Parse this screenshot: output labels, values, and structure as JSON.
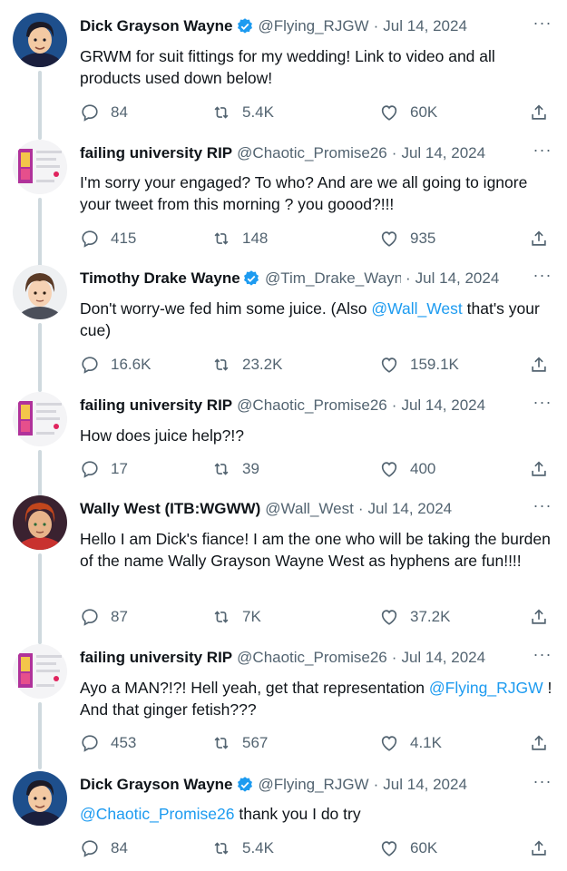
{
  "tweets": [
    {
      "name": "Dick Grayson Wayne",
      "verified": true,
      "handle": "@Flying_RJGW",
      "date": "Jul 14, 2024",
      "text_parts": [
        "GRWM for suit fittings for my wedding! Link to video and all products used down below!"
      ],
      "replies": "84",
      "retweets": "5.4K",
      "likes": "60K"
    },
    {
      "name": "failing university RIP",
      "verified": false,
      "handle": "@Chaotic_Promise26",
      "date": "Jul 14, 2024",
      "text_parts": [
        "I'm sorry your engaged? To who? And are we all going to ignore your tweet from this morning ? you goood?!!!"
      ],
      "replies": "415",
      "retweets": "148",
      "likes": "935"
    },
    {
      "name": "Timothy Drake Wayne",
      "verified": true,
      "handle": "@Tim_Drake_Wayne",
      "date": "Jul 14, 2024",
      "text_parts": [
        "Don't worry-we fed him some juice. (Also ",
        "@Wall_West",
        " that's your cue)"
      ],
      "replies": "16.6K",
      "retweets": "23.2K",
      "likes": "159.1K"
    },
    {
      "name": "failing university RIP",
      "verified": false,
      "handle": "@Chaotic_Promise26",
      "date": "Jul 14, 2024",
      "text_parts": [
        "How does juice help?!?"
      ],
      "replies": "17",
      "retweets": "39",
      "likes": "400"
    },
    {
      "name": "Wally West (ITB:WGWW)",
      "verified": false,
      "handle": "@Wall_West",
      "date": "Jul 14, 2024",
      "text_parts": [
        "Hello I am Dick's fiance! I am the one who will be taking the burden of the name Wally Grayson Wayne West as hyphens are fun!!!!"
      ],
      "replies": "87",
      "retweets": "7K",
      "likes": "37.2K"
    },
    {
      "name": "failing university RIP",
      "verified": false,
      "handle": "@Chaotic_Promise26",
      "date": "Jul 14, 2024",
      "text_parts": [
        "Ayo a MAN?!?! Hell yeah, get that representation ",
        "@Flying_RJGW",
        " ! And that ginger fetish???"
      ],
      "replies": "453",
      "retweets": "567",
      "likes": "4.1K"
    },
    {
      "name": "Dick Grayson Wayne",
      "verified": true,
      "handle": "@Flying_RJGW",
      "date": "Jul 14, 2024",
      "text_parts": [
        "",
        "@Chaotic_Promise26",
        " thank you I do try"
      ],
      "replies": "84",
      "retweets": "5.4K",
      "likes": "60K"
    }
  ],
  "separator": "·",
  "colors": {
    "accent": "#1d9bf0",
    "secondary_text": "#536471",
    "thread_line": "#cfd9de"
  }
}
